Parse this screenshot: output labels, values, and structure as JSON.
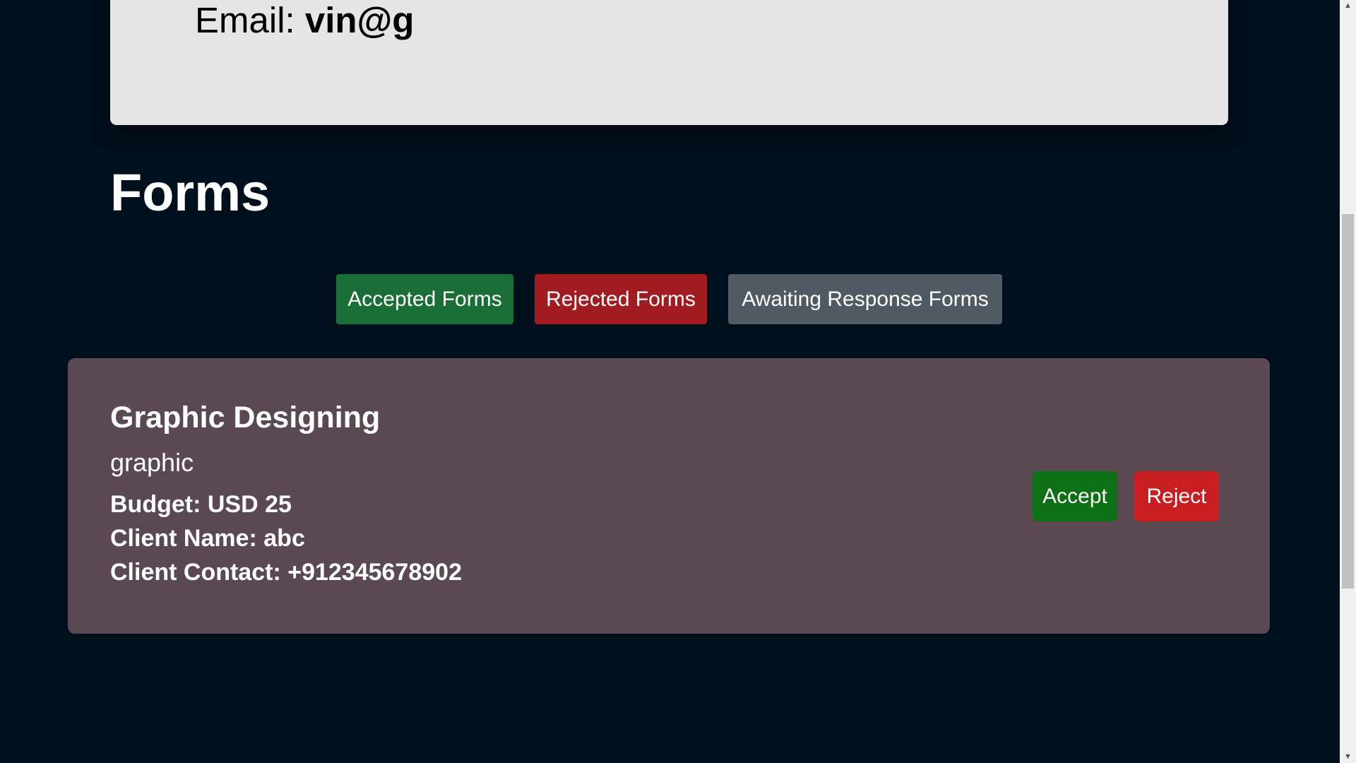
{
  "profile": {
    "email_label": "Email:",
    "email_value": "vin@g",
    "progress_fraction": 0.2
  },
  "forms_section": {
    "heading": "Forms",
    "filters": {
      "accepted": "Accepted Forms",
      "rejected": "Rejected Forms",
      "awaiting": "Awaiting Response Forms"
    },
    "items": [
      {
        "title": "Graphic Designing",
        "category": "graphic",
        "budget": "Budget: USD 25",
        "client_name": "Client Name: abc",
        "client_contact": "Client Contact: +912345678902",
        "accept_label": "Accept",
        "reject_label": "Reject"
      }
    ]
  },
  "scrollbar": {
    "up_arrow_icon": "▲",
    "down_arrow_icon": "▼"
  },
  "colors": {
    "page_background": "#000f1c",
    "profile_card": "#e5e5e5",
    "form_card": "#5b4951",
    "accepted_filter": "#1a6e38",
    "rejected_filter": "#a11c20",
    "awaiting_filter": "#4f5a63",
    "accept_button": "#0e7014",
    "reject_button": "#c81e21"
  }
}
